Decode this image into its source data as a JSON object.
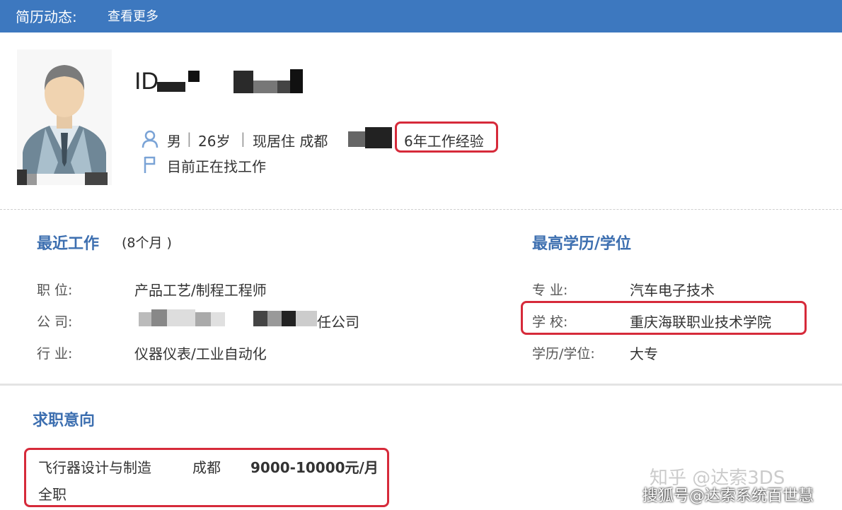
{
  "topbar": {
    "title": "简历动态:",
    "more_link": "查看更多"
  },
  "profile": {
    "id_label": "ID",
    "gender": "男",
    "age": "26岁",
    "residence": "现居住 成都",
    "experience": "6年工作经验",
    "job_status": "目前正在找工作",
    "separator": "|"
  },
  "recent_work": {
    "title": "最近工作",
    "duration": "(8个月 )",
    "fields": [
      {
        "label": "职   位:",
        "value": "产品工艺/制程工程师"
      },
      {
        "label": "公   司:",
        "value": "任公司"
      },
      {
        "label": "行   业:",
        "value": "仪器仪表/工业自动化"
      }
    ]
  },
  "education": {
    "title": "最高学历/学位",
    "fields": [
      {
        "label": "专   业:",
        "value": "汽车电子技术"
      },
      {
        "label": "学   校:",
        "value": "重庆海联职业技术学院"
      },
      {
        "label": "学历/学位:",
        "value": "大专"
      }
    ]
  },
  "job_intent": {
    "title": "求职意向",
    "position": "飞行器设计与制造",
    "city": "成都",
    "salary": "9000-10000元/月",
    "type": "全职"
  },
  "watermarks": {
    "zhihu": "知乎 @达索3DS",
    "sohu": "搜狐号@达索系统百世慧"
  },
  "colors": {
    "header_bg": "#3d78bf",
    "section_title": "#3d6fb0",
    "highlight_border": "#d62a3a"
  }
}
